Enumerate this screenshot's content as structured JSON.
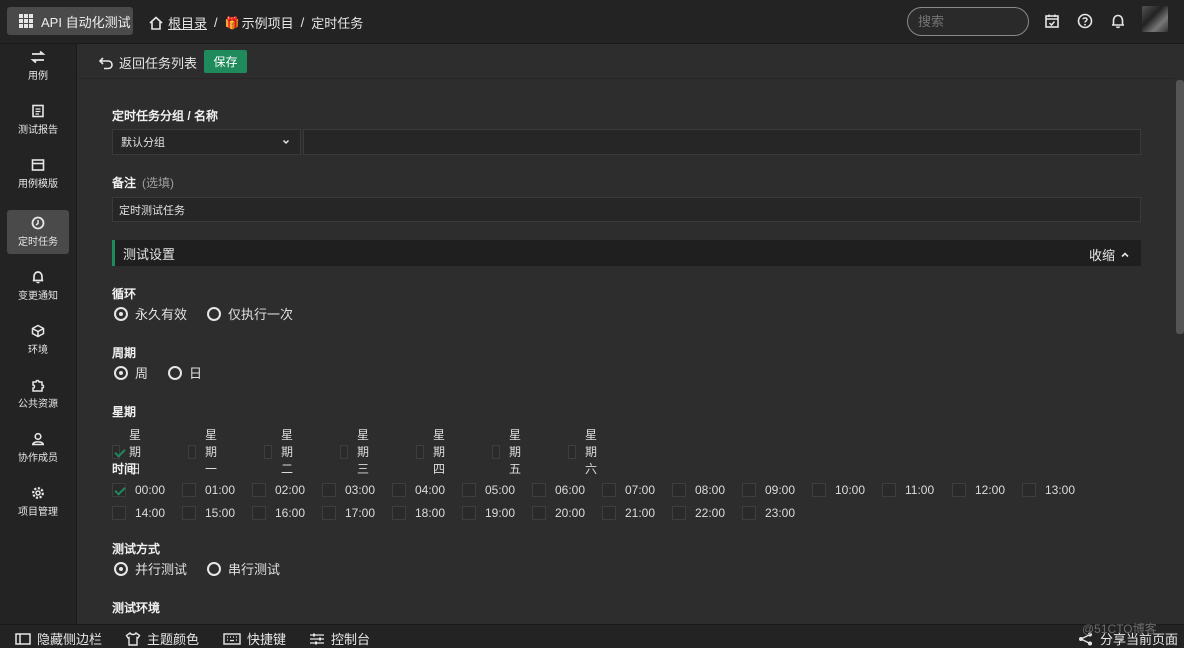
{
  "topbar": {
    "app_title": "API 自动化测试",
    "crumb_home": "根目录",
    "crumb_sep": "/",
    "crumb_project": "示例项目",
    "crumb_page": "定时任务",
    "search_placeholder": "搜索"
  },
  "sidebar": {
    "items": [
      {
        "label": "用例",
        "icon": "swap-arrows-icon"
      },
      {
        "label": "测试报告",
        "icon": "report-icon"
      },
      {
        "label": "用例模版",
        "icon": "template-icon"
      },
      {
        "label": "定时任务",
        "icon": "clock-icon",
        "active": true
      },
      {
        "label": "变更通知",
        "icon": "bell-icon"
      },
      {
        "label": "环境",
        "icon": "cube-icon"
      },
      {
        "label": "公共资源",
        "icon": "puzzle-icon"
      },
      {
        "label": "协作成员",
        "icon": "user-icon"
      },
      {
        "label": "项目管理",
        "icon": "gear-icon"
      }
    ]
  },
  "toolbar": {
    "back_label": "返回任务列表",
    "save_label": "保存"
  },
  "form": {
    "group_name_label": "定时任务分组 / 名称",
    "group_value": "默认分组",
    "name_value": "",
    "remark_label": "备注",
    "remark_optional": "(选填)",
    "remark_value": "定时测试任务"
  },
  "settings": {
    "title": "测试设置",
    "collapse_label": "收缩",
    "loop": {
      "label": "循环",
      "options": [
        "永久有效",
        "仅执行一次"
      ],
      "selected": 0
    },
    "period": {
      "label": "周期",
      "options": [
        "周",
        "日"
      ],
      "selected": 0
    },
    "weekday": {
      "label": "星期",
      "options": [
        "星期日",
        "星期一",
        "星期二",
        "星期三",
        "星期四",
        "星期五",
        "星期六"
      ],
      "checked": [
        0
      ]
    },
    "time": {
      "label": "时间",
      "row1": [
        "00:00",
        "01:00",
        "02:00",
        "03:00",
        "04:00",
        "05:00",
        "06:00",
        "07:00",
        "08:00",
        "09:00",
        "10:00",
        "11:00",
        "12:00",
        "13:00"
      ],
      "row2": [
        "14:00",
        "15:00",
        "16:00",
        "17:00",
        "18:00",
        "19:00",
        "20:00",
        "21:00",
        "22:00",
        "23:00"
      ],
      "checked": [
        "00:00"
      ]
    },
    "mode": {
      "label": "测试方式",
      "options": [
        "并行测试",
        "串行测试"
      ],
      "selected": 0
    },
    "env_label": "测试环境"
  },
  "bottombar": {
    "hide_sidebar": "隐藏侧边栏",
    "theme_color": "主题颜色",
    "shortcuts": "快捷键",
    "console": "控制台",
    "share": "分享当前页面"
  },
  "watermark": "@51CTO博客",
  "colors": {
    "accent": "#1f8a5c",
    "background": "#2d2d2d",
    "panel": "#232323"
  }
}
